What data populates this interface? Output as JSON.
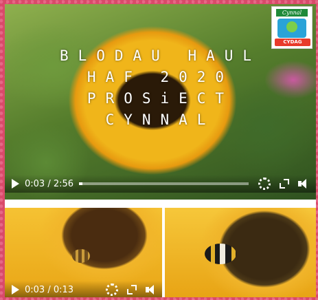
{
  "main_video": {
    "title_lines": [
      "BLODAU HAUL",
      "HAF 2020",
      "PROSiECT",
      "CYNNAL"
    ],
    "logo": {
      "ribbon_text": "Cynnal",
      "sub_text": "CYDAG"
    },
    "controls": {
      "time": "0:03 / 2:56",
      "progress": 0.02
    }
  },
  "thumb_videos": [
    {
      "time": "0:03 / 0:13"
    }
  ]
}
